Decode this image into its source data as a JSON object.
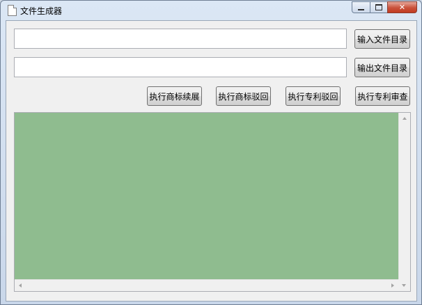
{
  "window": {
    "title": "文件生成器",
    "controls": {
      "minimize_icon": "minimize-icon",
      "maximize_icon": "maximize-icon",
      "close_icon": "close-icon",
      "close_glyph": "✕"
    }
  },
  "inputs": {
    "input_dir": {
      "value": "",
      "placeholder": ""
    },
    "output_dir": {
      "value": "",
      "placeholder": ""
    }
  },
  "buttons": {
    "input_dir_label": "输入文件目录",
    "output_dir_label": "输出文件目录",
    "trademark_renewal_label": "执行商标续展",
    "trademark_rejection_label": "执行商标驳回",
    "patent_rejection_label": "执行专利驳回",
    "patent_review_label": "执行专利审查"
  },
  "output_area": {
    "text": "",
    "background": "#8fbc8f"
  }
}
